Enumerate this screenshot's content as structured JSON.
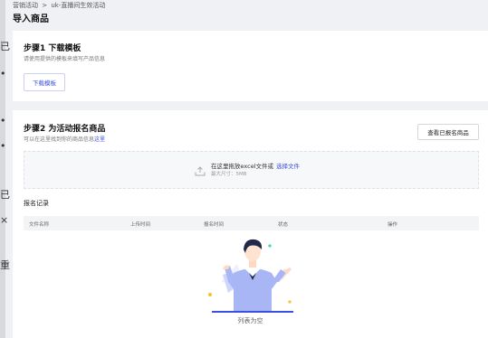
{
  "breadcrumb": {
    "items": [
      "营销活动",
      ">",
      "uk-直播间生效活动"
    ]
  },
  "page": {
    "title": "导入商品"
  },
  "edge_glyphs": [
    "已",
    "•",
    "•",
    "•",
    "已",
    "×",
    "重"
  ],
  "step1": {
    "title": "步骤1 下载模板",
    "desc": "请使用提供的模板来填写产品信息",
    "download_button": "下载模板"
  },
  "step2": {
    "title": "步骤2 为活动报名商品",
    "desc_prefix": "可以在这里找到你的商品信息",
    "desc_link": "这里",
    "view_button": "查看已报名商品"
  },
  "upload": {
    "prompt_prefix": "在这里拖放excel文件或",
    "prompt_link": "选择文件",
    "limit": "最大尺寸：5MB"
  },
  "records": {
    "title": "报名记录",
    "columns": [
      "文件名称",
      "上传时间",
      "报名时间",
      "状态",
      "操作"
    ],
    "empty_text": "列表为空"
  },
  "colors": {
    "accent": "#3b4fe0",
    "illustration_shirt": "#a9b6f5",
    "illustration_hair": "#1f2a4a"
  }
}
